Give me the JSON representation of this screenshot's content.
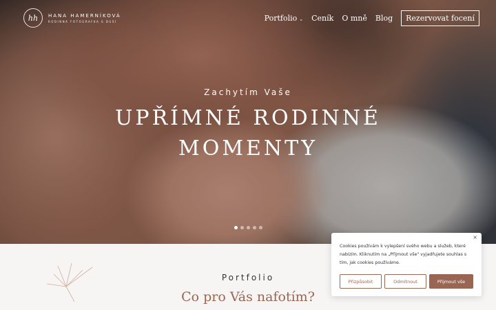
{
  "logo": {
    "mark": "hh",
    "name": "HANA HAMERNÍKOVÁ",
    "subtitle": "RODINNÁ FOTOGRAFKA S DUŠÍ"
  },
  "nav": {
    "items": [
      {
        "label": "Portfolio",
        "has_dropdown": true
      },
      {
        "label": "Ceník"
      },
      {
        "label": "O mně"
      },
      {
        "label": "Blog"
      }
    ],
    "cta": "Rezervovat focení",
    "dropdown_icon": "chevron-down-icon"
  },
  "hero": {
    "subtitle": "Zachytím Vaše",
    "title_line1": "UPŘÍMNÉ RODINNÉ",
    "title_line2": "MOMENTY",
    "slides": {
      "count": 5,
      "active_index": 0
    }
  },
  "section": {
    "label": "Portfolio",
    "title": "Co pro Vás nafotím?"
  },
  "cookie": {
    "text": "Cookies používám k vylepšení svého webu a služeb, které nabízím. Kliknutím na „Přijmout vše\" vyjadřujete souhlas s tím, jak cookies používáme.",
    "close": "×",
    "buttons": {
      "settings": "Přizpůsobit",
      "reject": "Odmítnout",
      "accept": "Přijmout vše"
    }
  },
  "colors": {
    "accent": "#9a6552",
    "white": "#ffffff",
    "section_bg": "#f6f5f4"
  }
}
